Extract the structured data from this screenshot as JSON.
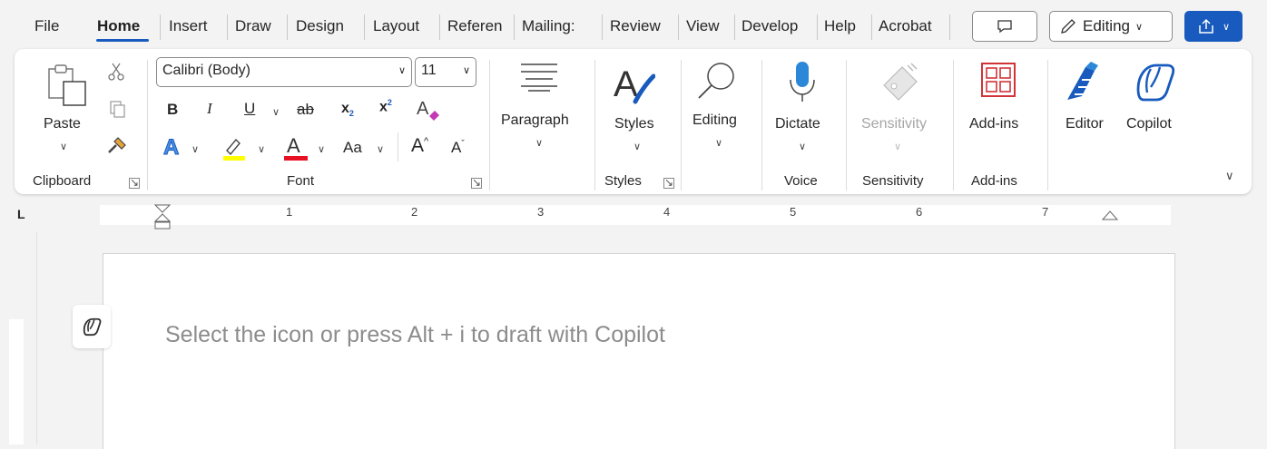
{
  "tabs": [
    {
      "label": "File"
    },
    {
      "label": "Home",
      "active": true
    },
    {
      "label": "Insert"
    },
    {
      "label": "Draw"
    },
    {
      "label": "Design"
    },
    {
      "label": "Layout"
    },
    {
      "label": "Referen"
    },
    {
      "label": "Mailing:"
    },
    {
      "label": "Review"
    },
    {
      "label": "View"
    },
    {
      "label": "Develop"
    },
    {
      "label": "Help"
    },
    {
      "label": "Acrobat"
    }
  ],
  "header": {
    "editing_label": "Editing",
    "comment_icon": "comment-icon",
    "share_icon": "share-icon",
    "accent": "#185abd"
  },
  "ribbon": {
    "clipboard": {
      "paste": "Paste",
      "group": "Clipboard"
    },
    "font": {
      "font_name": "Calibri (Body)",
      "font_size": "11",
      "group": "Font",
      "case_label": "Aa"
    },
    "paragraph": {
      "label": "Paragraph"
    },
    "styles": {
      "label": "Styles",
      "group": "Styles"
    },
    "editing": {
      "label": "Editing"
    },
    "voice": {
      "label": "Dictate",
      "group": "Voice"
    },
    "sensitivity": {
      "label": "Sensitivity",
      "group": "Sensitivity"
    },
    "addins": {
      "label": "Add-ins",
      "group": "Add-ins"
    },
    "editor": {
      "label": "Editor"
    },
    "copilot": {
      "label": "Copilot"
    }
  },
  "ruler": {
    "numbers": [
      "1",
      "2",
      "3",
      "4",
      "5",
      "6",
      "7"
    ]
  },
  "document": {
    "placeholder": "Select the icon or press Alt + i to draft with Copilot"
  }
}
